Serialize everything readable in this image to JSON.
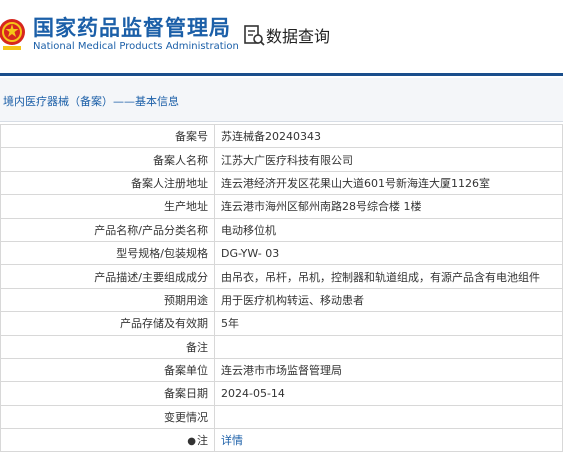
{
  "header": {
    "agency_cn": "国家药品监督管理局",
    "agency_en": "National Medical Products Administration",
    "query_label": "数据查询",
    "brand_color": "#1b5fa8",
    "bar_color": "#1a4e8c"
  },
  "breadcrumb": {
    "text": "境内医疗器械（备案）——基本信息"
  },
  "rows": [
    {
      "label": "备案号",
      "value": "苏连械备20240343"
    },
    {
      "label": "备案人名称",
      "value": "江苏大广医疗科技有限公司"
    },
    {
      "label": "备案人注册地址",
      "value": "连云港经济开发区花果山大道601号新海连大厦1126室"
    },
    {
      "label": "生产地址",
      "value": "连云港市海州区郁州南路28号综合楼 1楼"
    },
    {
      "label": "产品名称/产品分类名称",
      "value": "电动移位机"
    },
    {
      "label": "型号规格/包装规格",
      "value": "DG-YW- 03"
    },
    {
      "label": "产品描述/主要组成成分",
      "value": "由吊衣，吊杆，吊机，控制器和轨道组成，有源产品含有电池组件"
    },
    {
      "label": "预期用途",
      "value": "用于医疗机构转运、移动患者"
    },
    {
      "label": "产品存储及有效期",
      "value": "5年"
    },
    {
      "label": "备注",
      "value": ""
    },
    {
      "label": "备案单位",
      "value": "连云港市市场监督管理局"
    },
    {
      "label": "备案日期",
      "value": "2024-05-14"
    },
    {
      "label": "变更情况",
      "value": ""
    },
    {
      "label": "注",
      "value": "详情",
      "icon": "pin-icon"
    }
  ]
}
